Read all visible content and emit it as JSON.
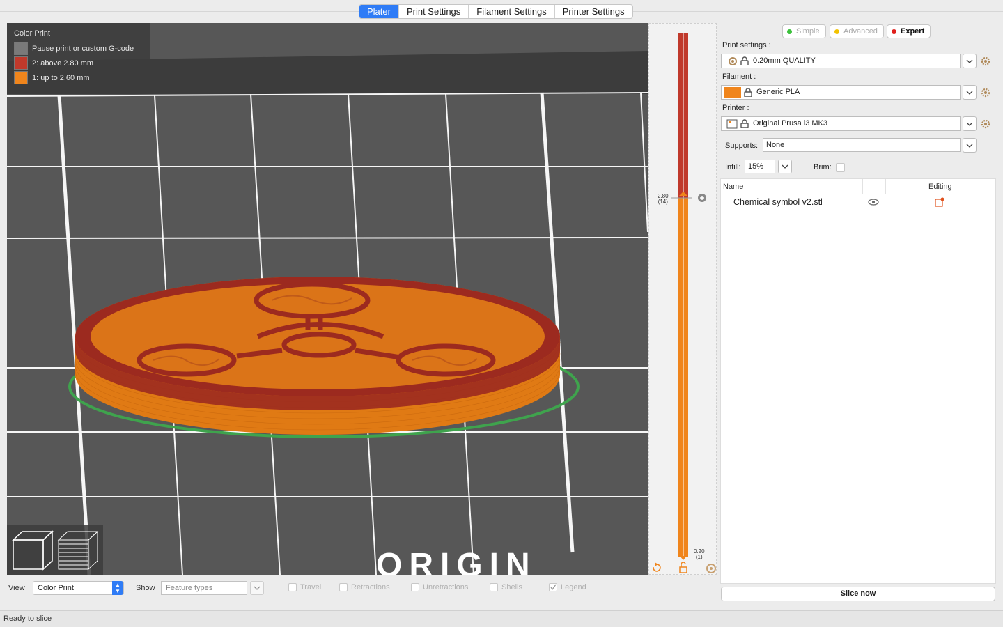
{
  "tabs": [
    "Plater",
    "Print Settings",
    "Filament Settings",
    "Printer Settings"
  ],
  "legend": {
    "title": "Color Print",
    "items": [
      {
        "label": "Pause print or custom G-code",
        "color": "#7a7a7a"
      },
      {
        "label": "2: above 2.80 mm",
        "color": "#c0392b"
      },
      {
        "label": "1: up to 2.60 mm",
        "color": "#f0851c"
      }
    ]
  },
  "scene": {
    "bed_text": "ORIGIN",
    "model_color": "#e07a14",
    "top_color": "#9c2a1f",
    "skirt_color": "#3fa34d"
  },
  "slider": {
    "top_value": "2.80",
    "top_layer": "(14)",
    "bottom_value": "0.20",
    "bottom_layer": "(1)",
    "upper_color": "#c0392b",
    "lower_color": "#f0851c"
  },
  "bottombar": {
    "view_label": "View",
    "view_value": "Color Print",
    "show_label": "Show",
    "show_placeholder": "Feature types",
    "checks": [
      {
        "label": "Travel",
        "checked": false
      },
      {
        "label": "Retractions",
        "checked": false
      },
      {
        "label": "Unretractions",
        "checked": false
      },
      {
        "label": "Shells",
        "checked": false
      },
      {
        "label": "Legend",
        "checked": true
      }
    ]
  },
  "modes": [
    {
      "label": "Simple",
      "color": "#3cc13c",
      "active": false
    },
    {
      "label": "Advanced",
      "color": "#f2c200",
      "active": false
    },
    {
      "label": "Expert",
      "color": "#e0201c",
      "active": true
    }
  ],
  "settings": {
    "print_label": "Print settings :",
    "print_value": "0.20mm QUALITY",
    "filament_label": "Filament :",
    "filament_value": "Generic PLA",
    "filament_color": "#f0851c",
    "printer_label": "Printer :",
    "printer_value": "Original Prusa i3 MK3",
    "supports_label": "Supports:",
    "supports_value": "None",
    "infill_label": "Infill:",
    "infill_value": "15%",
    "brim_label": "Brim:"
  },
  "objects": {
    "col_name": "Name",
    "col_editing": "Editing",
    "rows": [
      {
        "name": "Chemical symbol v2.stl"
      }
    ]
  },
  "slice_button": "Slice now",
  "status": "Ready to slice"
}
